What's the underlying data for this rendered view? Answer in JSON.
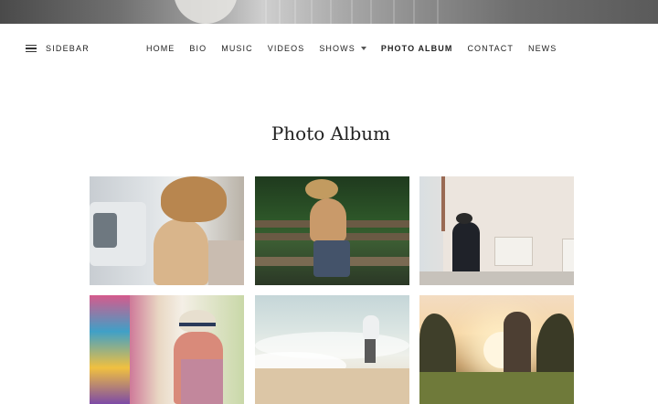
{
  "header": {
    "sidebar_label": "SIDEBAR",
    "sidebar_icon": "hamburger-icon"
  },
  "nav": {
    "items": [
      {
        "label": "HOME"
      },
      {
        "label": "BIO"
      },
      {
        "label": "MUSIC"
      },
      {
        "label": "VIDEOS"
      },
      {
        "label": "SHOWS",
        "has_dropdown": true
      },
      {
        "label": "PHOTO ALBUM",
        "active": true
      },
      {
        "label": "CONTACT"
      },
      {
        "label": "NEWS"
      }
    ]
  },
  "main": {
    "title": "Photo Album",
    "photos": [
      {
        "subject": "woman-in-straw-hat-by-truck"
      },
      {
        "subject": "woman-in-hat-on-park-bench"
      },
      {
        "subject": "woman-in-black-hat-walking-by-brick-wall"
      },
      {
        "subject": "woman-in-striped-hat-by-graffiti"
      },
      {
        "subject": "woman-walking-on-beach"
      },
      {
        "subject": "woman-silhouette-in-sunlit-field"
      }
    ]
  },
  "colors": {
    "text": "#222222",
    "background": "#ffffff"
  }
}
